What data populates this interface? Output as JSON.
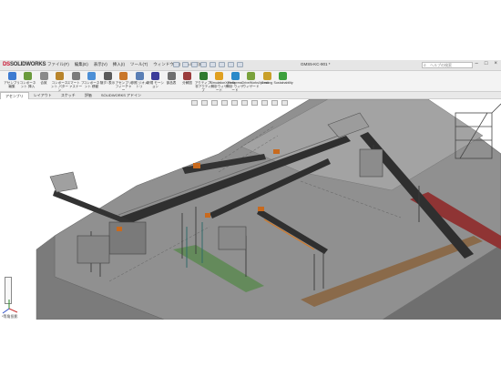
{
  "app": {
    "logo_brand": "DS",
    "logo_name": "SOLIDWORKS",
    "document_title": "GMS5-KC-901 *",
    "search_placeholder": "ヘルプの検索",
    "menu": [
      "ファイル(F)",
      "編集(E)",
      "表示(V)",
      "挿入(I)",
      "ツール(T)",
      "ウィンドウ(W)",
      "ヘルプ(H)"
    ]
  },
  "ribbon": {
    "buttons": [
      {
        "label": "アセンブリ 編集",
        "icon": "edit-assembly-icon",
        "color": "#3d7bd1"
      },
      {
        "label": "コンポーネント 挿入",
        "icon": "insert-component-icon",
        "color": "#6a9a3c"
      },
      {
        "label": "合致",
        "icon": "mate-icon",
        "color": "#8a8a8a"
      },
      {
        "label": "コンポーネント パターン",
        "icon": "component-pattern-icon",
        "color": "#b9852c"
      },
      {
        "label": "スマート ファスナー",
        "icon": "smart-fastener-icon",
        "color": "#7a7a7a"
      },
      {
        "label": "コンポーネント 移動",
        "icon": "move-component-icon",
        "color": "#4c8fd6"
      },
      {
        "label": "隠す/ 表示",
        "icon": "show-hide-icon",
        "color": "#5a5a5a"
      },
      {
        "label": "アセンブリ フィーチャー",
        "icon": "assembly-feature-icon",
        "color": "#c9772a"
      },
      {
        "label": "参照 ジオメトリ",
        "icon": "reference-geometry-icon",
        "color": "#5a7fb5"
      },
      {
        "label": "新規 モーション",
        "icon": "new-motion-icon",
        "color": "#3c3c9a"
      },
      {
        "label": "部品表",
        "icon": "bom-icon",
        "color": "#6f6f6f"
      },
      {
        "label": "分解図",
        "icon": "exploded-view-icon",
        "color": "#9a3c3c"
      },
      {
        "label": "アクティブ/非アクティブ",
        "icon": "instant3d-icon",
        "color": "#2f7a2f"
      },
      {
        "label": "SimulationXpress 解析ウィザード",
        "icon": "simulation-icon",
        "color": "#e0a020"
      },
      {
        "label": "FloXpress 解析 ウィザード",
        "icon": "floxpress-icon",
        "color": "#2a8ac9"
      },
      {
        "label": "DriveWorksXpress ウィザード",
        "icon": "driveworks-icon",
        "color": "#7aa23c"
      },
      {
        "label": "Costing",
        "icon": "costing-icon",
        "color": "#c9a02a"
      },
      {
        "label": "Sustainability",
        "icon": "sustainability-icon",
        "color": "#3ca03c"
      }
    ]
  },
  "tabs": [
    "アセンブリ",
    "レイアウト",
    "スケッチ",
    "評価",
    "SOLIDWORKS アドイン"
  ],
  "viewport": {
    "view_label": "*等角投影"
  },
  "colors": {
    "floor": "#8f8f8f",
    "floor_dark": "#6e6e6e",
    "steel": "#5a5a5a",
    "conveyor_belt": "#2f2f2f",
    "motor_orange": "#c86a1e",
    "green_strip": "#5f8a55",
    "red_strip": "#9a3030",
    "orange_rail": "#d07a2a"
  }
}
